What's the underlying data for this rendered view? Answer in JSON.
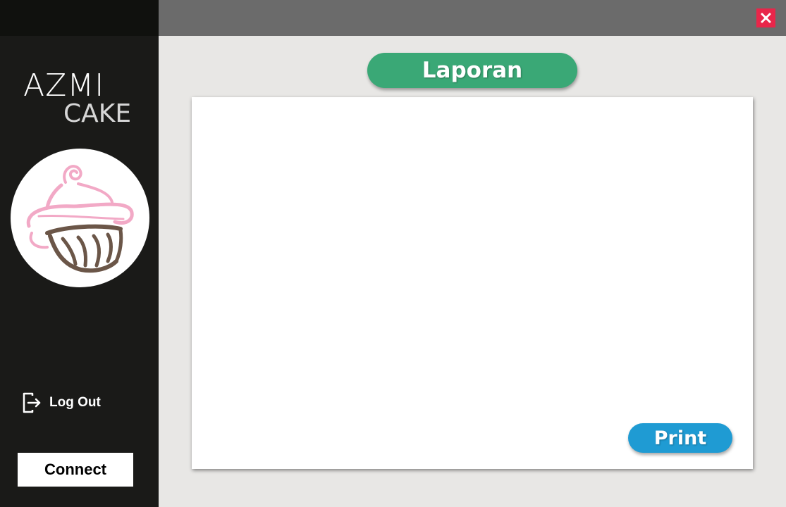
{
  "brand": {
    "line1": "AZMI",
    "line2": "CAKE",
    "logo_icon": "cupcake-logo-icon"
  },
  "sidebar": {
    "logout_label": "Log Out",
    "logout_icon": "logout-icon",
    "connect_label": "Connect"
  },
  "titlebar": {
    "close_icon": "close-icon"
  },
  "main": {
    "title": "Laporan",
    "print_label": "Print"
  },
  "colors": {
    "sidebar_bg": "#1a1a18",
    "topbar_bg": "#6b6b6b",
    "content_bg": "#e8e7e5",
    "title_pill": "#3aa876",
    "print_button": "#1f9bd3",
    "close_button": "#e8264a",
    "logo_pink": "#f2a9c6",
    "logo_brown": "#6b5648"
  }
}
